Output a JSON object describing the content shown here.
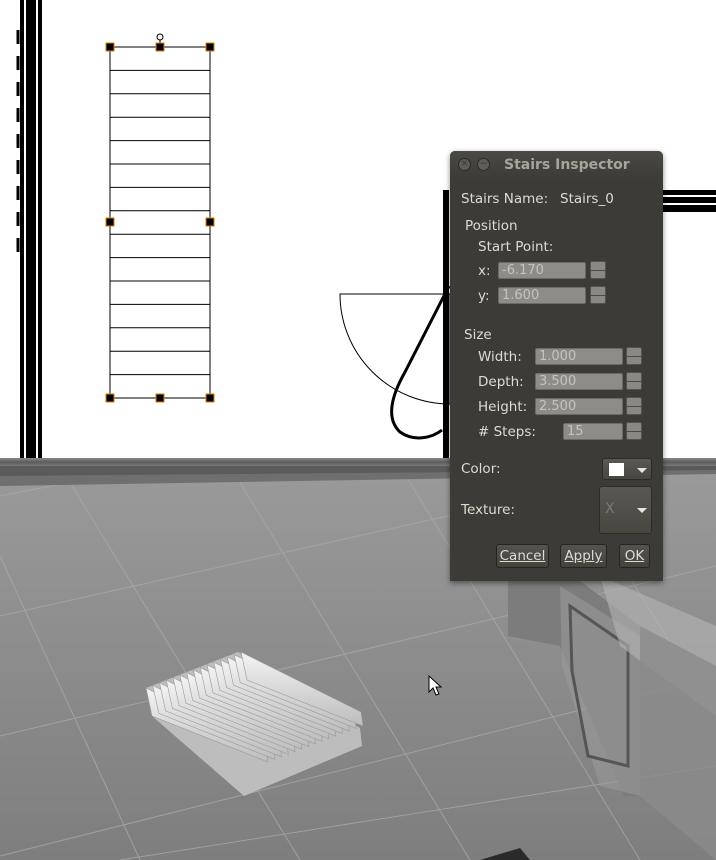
{
  "dialog": {
    "title": "Stairs Inspector",
    "close_icon": "close-icon",
    "minimize_icon": "minimize-icon",
    "stairs_name_label": "Stairs Name:",
    "stairs_name_value": "Stairs_0",
    "position_label": "Position",
    "start_point_label": "Start Point:",
    "x_label": "x:",
    "x_value": "-6.170",
    "y_label": "y:",
    "y_value": "1.600",
    "size_label": "Size",
    "width_label": "Width:",
    "width_value": "1.000",
    "depth_label": "Depth:",
    "depth_value": "3.500",
    "height_label": "Height:",
    "height_value": "2.500",
    "steps_label": "# Steps:",
    "steps_value": "15",
    "color_label": "Color:",
    "color_value": "#ffffff",
    "texture_label": "Texture:",
    "texture_value": "X",
    "cancel_label": "Cancel",
    "apply_label": "Apply",
    "ok_label": "OK"
  },
  "colors": {
    "dialog_bg": "#3c3b37",
    "selection_handle": "#e07b00",
    "floor_3d": "#8d8d8d"
  }
}
